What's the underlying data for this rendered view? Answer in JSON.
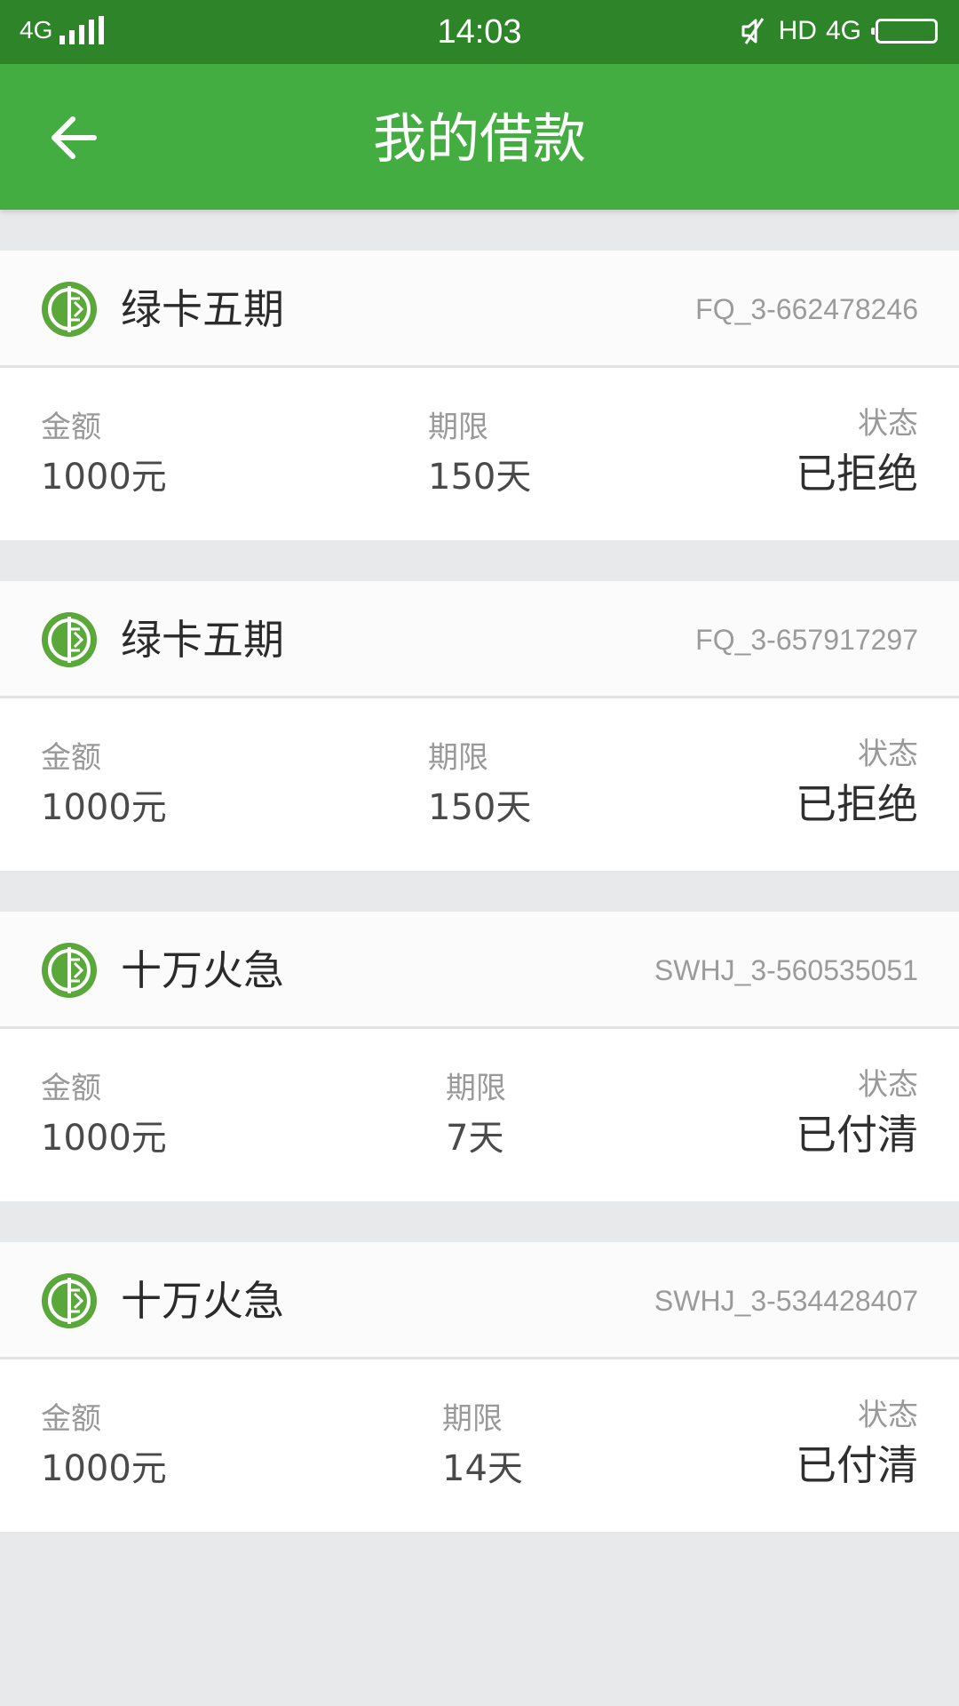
{
  "status_bar": {
    "network": "4G",
    "time": "14:03",
    "hd": "HD",
    "mobile_data": "4G"
  },
  "app_bar": {
    "title": "我的借款"
  },
  "labels": {
    "amount": "金额",
    "term": "期限",
    "status": "状态"
  },
  "loans": [
    {
      "product": "绿卡五期",
      "order_id": "FQ_3-662478246",
      "amount": "1000元",
      "term": "150天",
      "status": "已拒绝"
    },
    {
      "product": "绿卡五期",
      "order_id": "FQ_3-657917297",
      "amount": "1000元",
      "term": "150天",
      "status": "已拒绝"
    },
    {
      "product": "十万火急",
      "order_id": "SWHJ_3-560535051",
      "amount": "1000元",
      "term": "7天",
      "status": "已付清"
    },
    {
      "product": "十万火急",
      "order_id": "SWHJ_3-534428407",
      "amount": "1000元",
      "term": "14天",
      "status": "已付清"
    }
  ],
  "colors": {
    "status_bar": "#2e8429",
    "app_bar": "#43ad41",
    "logo_green": "#5aa83a",
    "background": "#e8e9eb"
  }
}
